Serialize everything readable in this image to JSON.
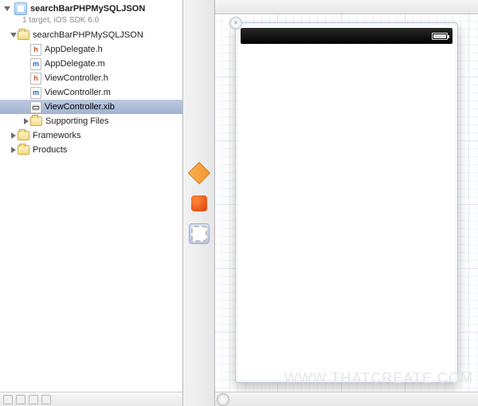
{
  "project": {
    "name": "searchBarPHPMySQLJSON",
    "subtitle": "1 target, iOS SDK 6.0"
  },
  "tree": {
    "root": {
      "label": "searchBarPHPMySQLJSON",
      "children": [
        {
          "label": "AppDelegate.h",
          "kind": "h"
        },
        {
          "label": "AppDelegate.m",
          "kind": "m"
        },
        {
          "label": "ViewController.h",
          "kind": "h"
        },
        {
          "label": "ViewController.m",
          "kind": "m"
        },
        {
          "label": "ViewController.xib",
          "kind": "xib",
          "selected": true
        },
        {
          "label": "Supporting Files",
          "kind": "folder"
        }
      ]
    },
    "frameworks": {
      "label": "Frameworks"
    },
    "products": {
      "label": "Products"
    }
  },
  "dock": {
    "items": [
      {
        "name": "placeholder-cube",
        "kind": "cube"
      },
      {
        "name": "first-responder",
        "kind": "orange"
      },
      {
        "name": "view",
        "kind": "view",
        "selected": true
      }
    ]
  },
  "icons": {
    "close_glyph": "×"
  },
  "watermark": "WWW.THATCREATE.COM"
}
